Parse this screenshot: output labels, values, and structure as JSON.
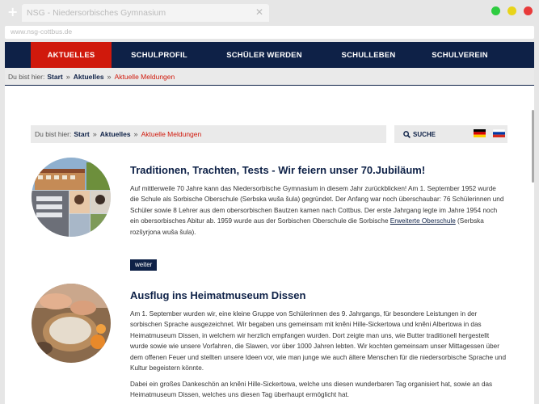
{
  "browser": {
    "tab_title": "NSG - Niedersorbisches Gymnasium",
    "url": "www.nsg-cottbus.de",
    "colors": {
      "close": "#e83a3a",
      "minimize": "#e8d41a",
      "maximize": "#2ecc40"
    }
  },
  "nav": {
    "items": [
      {
        "label": "AKTUELLES",
        "active": true
      },
      {
        "label": "SCHULPROFIL",
        "active": false
      },
      {
        "label": "SCHÜLER WERDEN",
        "active": false
      },
      {
        "label": "SCHULLEBEN",
        "active": false
      },
      {
        "label": "SCHULVEREIN",
        "active": false
      }
    ],
    "colors": {
      "background": "#0e2147",
      "active": "#d0190c"
    }
  },
  "breadcrumb_top": {
    "label": "Du bist hier:",
    "items": [
      "Start",
      "Aktuelles"
    ],
    "current": "Aktuelle Meldungen"
  },
  "breadcrumb_inner": {
    "label": "Du bist hier:",
    "items": [
      "Start",
      "Aktuelles"
    ],
    "current": "Aktuelle Meldungen"
  },
  "search": {
    "label": "SUCHE",
    "icon": "search-icon"
  },
  "languages": [
    "german-flag-icon",
    "russian-flag-icon"
  ],
  "articles": [
    {
      "title": "Traditionen, Trachten, Tests - Wir feiern unser 70.Jubiläum!",
      "body_before_link": "Auf mittlerweile 70 Jahre kann das Niedersorbische Gymnasium in diesem Jahr zurückblicken! Am 1. September 1952 wurde die Schule als Sorbische Oberschule (Serbska wuša šula) gegründet. Der Anfang war noch überschaubar: 76 Schülerinnen und Schüler sowie 8 Lehrer aus dem obersorbischen Bautzen kamen nach Cottbus. Der erste Jahrgang legte im Jahre 1954 noch ein obersorbisches Abitur ab. 1959 wurde aus der Sorbischen Oberschule die Sorbische ",
      "link_text": "Erweiterte Oberschule",
      "body_after_link": " (Serbska rozšyrjona wuša šula).",
      "more_label": "weiter"
    },
    {
      "title": "Ausflug ins Heimatmuseum Dissen",
      "paragraph_1": "Am 1. September wurden wir, eine kleine Gruppe von Schülerinnen des 9. Jahrgangs, für besondere Leistungen in der sorbischen Sprache ausgezeichnet. Wir begaben uns gemeinsam mit knĕni Hille-Sickertowa und knĕni Albertowa in das Heimatmuseum Dissen, in welchem wir herzlich empfangen wurden. Dort zeigte man uns, wie Butter traditionell hergestellt wurde sowie wie unsere Vorfahren, die Slawen, vor über 1000 Jahren lebten. Wir kochten gemeinsam unser Mittagessen über dem offenen Feuer und stellten unsere Ideen vor, wie man junge wie auch ältere Menschen für die niedersorbische Sprache und Kultur begeistern könnte.",
      "paragraph_2": "Dabei ein großes Dankeschön an knĕni Hille-Sickertowa, welche uns diesen wunderbaren Tag organisiert hat, sowie an das Heimatmuseum Dissen, welches uns diesen Tag überhaupt ermöglicht hat."
    }
  ]
}
